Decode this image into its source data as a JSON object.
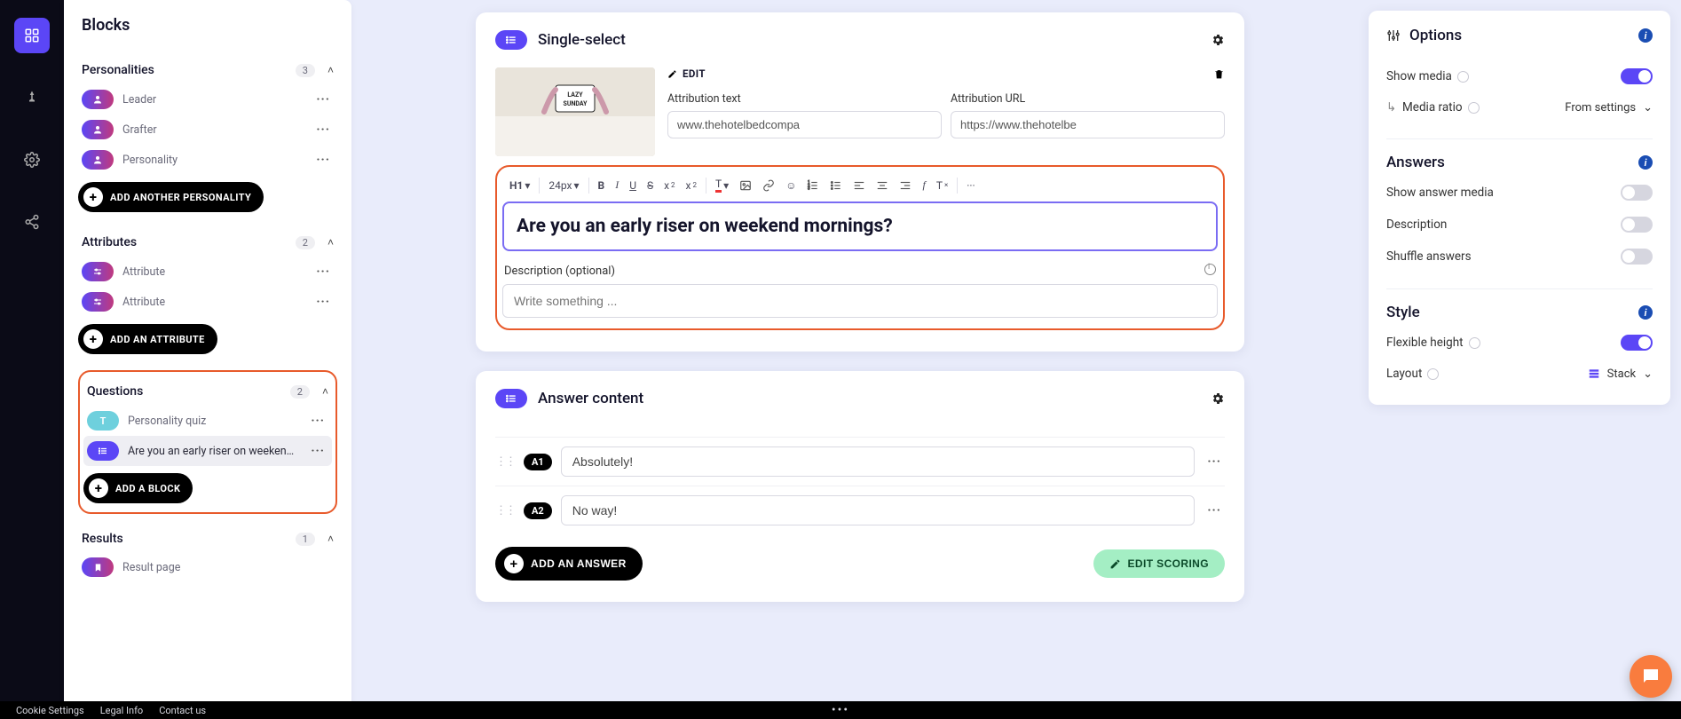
{
  "blocksPanel": {
    "title": "Blocks",
    "personalities": {
      "label": "Personalities",
      "count": "3",
      "items": [
        {
          "label": "Leader"
        },
        {
          "label": "Grafter"
        },
        {
          "label": "Personality"
        }
      ],
      "add": "ADD ANOTHER PERSONALITY"
    },
    "attributes": {
      "label": "Attributes",
      "count": "2",
      "items": [
        {
          "label": "Attribute"
        },
        {
          "label": "Attribute"
        }
      ],
      "add": "ADD AN ATTRIBUTE"
    },
    "questions": {
      "label": "Questions",
      "count": "2",
      "items": [
        {
          "label": "Personality quiz",
          "badge": "T"
        },
        {
          "label": "Are you an early riser on weekend ..."
        }
      ],
      "add": "ADD A BLOCK"
    },
    "results": {
      "label": "Results",
      "count": "1",
      "items": [
        {
          "label": "Result page"
        }
      ]
    }
  },
  "singleSelect": {
    "title": "Single-select",
    "editLabel": "EDIT",
    "attrText": {
      "label": "Attribution text",
      "value": "www.thehotelbedcompa"
    },
    "attrUrl": {
      "label": "Attribution URL",
      "value": "https://www.thehotelbe"
    },
    "toolbar": {
      "heading": "H1",
      "size": "24px"
    },
    "question": "Are you an early riser on weekend mornings?",
    "descLabel": "Description (optional)",
    "descPlaceholder": "Write something ..."
  },
  "answerContent": {
    "title": "Answer content",
    "answers": [
      {
        "badge": "A1",
        "value": "Absolutely!"
      },
      {
        "badge": "A2",
        "value": "No way!"
      }
    ],
    "addAnswer": "ADD AN ANSWER",
    "editScoring": "EDIT SCORING"
  },
  "options": {
    "title": "Options",
    "showMedia": "Show media",
    "mediaRatio": "Media ratio",
    "mediaRatioValue": "From settings",
    "answersTitle": "Answers",
    "showAnswerMedia": "Show answer media",
    "description": "Description",
    "shuffle": "Shuffle answers",
    "styleTitle": "Style",
    "flexHeight": "Flexible height",
    "layout": "Layout",
    "layoutValue": "Stack"
  },
  "footer": {
    "cookie": "Cookie Settings",
    "legal": "Legal Info",
    "contact": "Contact us"
  }
}
